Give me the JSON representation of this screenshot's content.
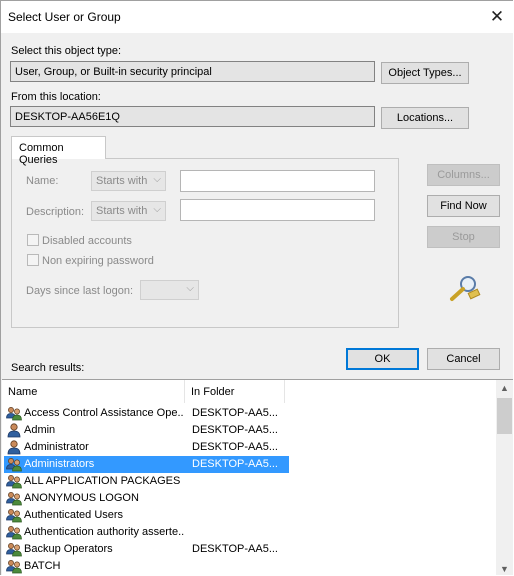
{
  "window": {
    "title": "Select User or Group"
  },
  "object_type": {
    "label": "Select this object type:",
    "value": "User, Group, or Built-in security principal",
    "button": "Object Types..."
  },
  "location": {
    "label": "From this location:",
    "value": "DESKTOP-AA56E1Q",
    "button": "Locations..."
  },
  "common_queries": {
    "tab": "Common Queries",
    "name_label": "Name:",
    "name_mode": "Starts with",
    "description_label": "Description:",
    "description_mode": "Starts with",
    "disabled_accounts": "Disabled accounts",
    "non_expiring_password": "Non expiring password",
    "days_label": "Days since last logon:"
  },
  "buttons": {
    "columns": "Columns...",
    "find_now": "Find Now",
    "stop": "Stop",
    "ok": "OK",
    "cancel": "Cancel"
  },
  "results": {
    "label": "Search results:",
    "columns": [
      "Name",
      "In Folder"
    ],
    "rows": [
      {
        "name": "Access Control Assistance Ope...",
        "folder": "DESKTOP-AA5...",
        "icon": "group-icon"
      },
      {
        "name": "Admin",
        "folder": "DESKTOP-AA5...",
        "icon": "user-icon"
      },
      {
        "name": "Administrator",
        "folder": "DESKTOP-AA5...",
        "icon": "user-icon"
      },
      {
        "name": "Administrators",
        "folder": "DESKTOP-AA5...",
        "icon": "group-icon",
        "selected": true
      },
      {
        "name": "ALL APPLICATION PACKAGES",
        "folder": "",
        "icon": "group-icon"
      },
      {
        "name": "ANONYMOUS LOGON",
        "folder": "",
        "icon": "group-icon"
      },
      {
        "name": "Authenticated Users",
        "folder": "",
        "icon": "group-icon"
      },
      {
        "name": "Authentication authority asserte...",
        "folder": "",
        "icon": "group-icon"
      },
      {
        "name": "Backup Operators",
        "folder": "DESKTOP-AA5...",
        "icon": "group-icon"
      },
      {
        "name": "BATCH",
        "folder": "",
        "icon": "group-icon"
      }
    ]
  },
  "colors": {
    "accent": "#0078d7",
    "selection": "#3399ff"
  }
}
